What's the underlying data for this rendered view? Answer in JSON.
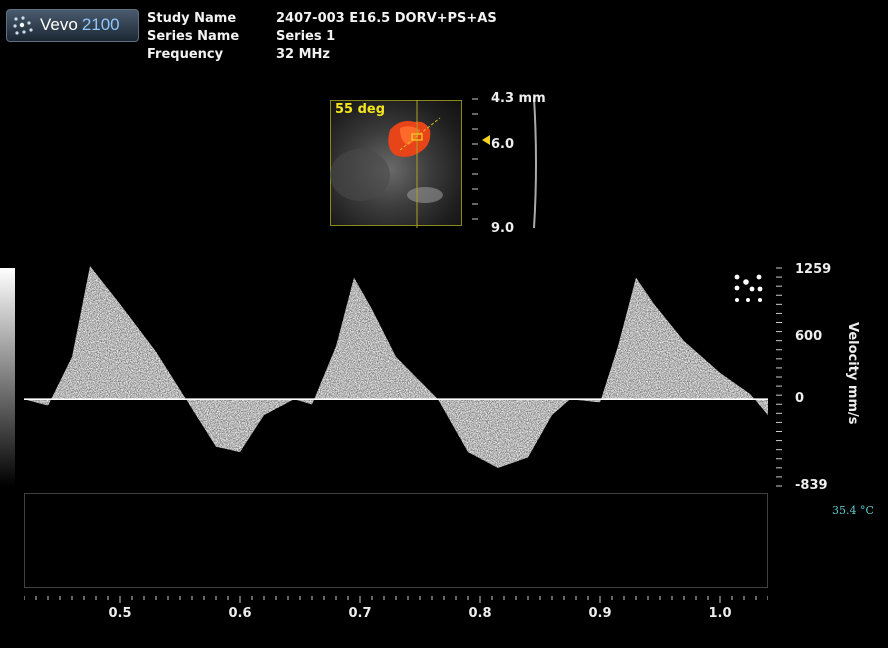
{
  "app": {
    "logo_name": "Vevo",
    "logo_version": "2100"
  },
  "study": {
    "rows": [
      {
        "label": "Study Name",
        "value": "2407-003 E16.5 DORV+PS+AS"
      },
      {
        "label": "Series Name",
        "value": "Series 1"
      },
      {
        "label": "Frequency",
        "value": "32 MHz"
      }
    ]
  },
  "bmode": {
    "angle_label": "55 deg",
    "depth_top": "4.3 mm",
    "depth_mid": "6.0",
    "depth_bottom": "9.0",
    "colors": {
      "flow": "#e8441a",
      "box": "#8a8a1a",
      "angle_text": "#f3e61e",
      "marker": "#f3d41e"
    }
  },
  "doppler": {
    "velocity_labels": {
      "max": "1259",
      "mid": "600",
      "zero": "0",
      "min": "-839"
    },
    "velocity_axis_title": "Velocity mm/s",
    "temperature": "35.4 °C",
    "time_labels": [
      "0.5",
      "0.6",
      "0.7",
      "0.8",
      "0.9",
      "1.0"
    ],
    "icon": "spectral-doppler-icon"
  },
  "chart_data": {
    "type": "line",
    "title": "",
    "xlabel": "",
    "ylabel": "Velocity mm/s",
    "ylim": [
      -839,
      1259
    ],
    "xlim": [
      0.42,
      1.04
    ],
    "x_ticks": [
      0.5,
      0.6,
      0.7,
      0.8,
      0.9,
      1.0
    ],
    "y_ticks": [
      1259,
      600,
      0,
      -839
    ],
    "series": [
      {
        "values_note": "",
        "x": [
          0.42,
          0.44,
          0.46,
          0.475,
          0.5,
          0.53,
          0.555,
          0.58,
          0.6,
          0.62,
          0.645,
          0.66,
          0.68,
          0.695,
          0.71,
          0.73,
          0.765,
          0.79,
          0.815,
          0.84,
          0.86,
          0.875,
          0.9,
          0.915,
          0.93,
          0.945,
          0.97,
          1.0,
          1.025,
          1.04
        ],
        "y": [
          0,
          -60,
          400,
          1259,
          900,
          450,
          0,
          -450,
          -500,
          -150,
          0,
          -50,
          500,
          1150,
          850,
          400,
          0,
          -500,
          -650,
          -550,
          -150,
          0,
          -30,
          500,
          1150,
          900,
          550,
          250,
          50,
          -150
        ]
      }
    ]
  }
}
